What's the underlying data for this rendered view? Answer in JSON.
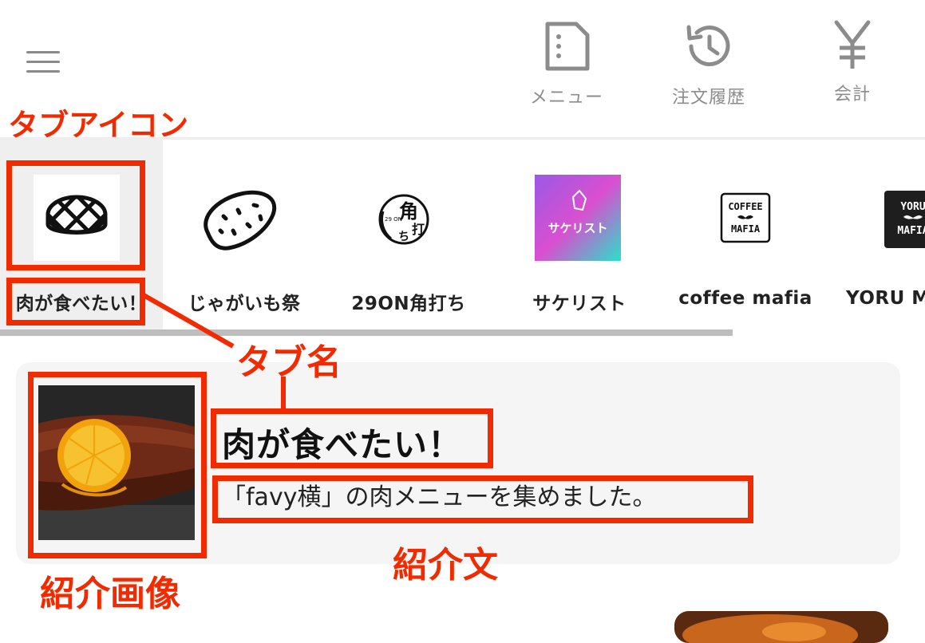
{
  "header": {
    "nav": [
      {
        "label": "メニュー",
        "icon": "menu-document-icon"
      },
      {
        "label": "注文履歴",
        "icon": "history-icon"
      },
      {
        "label": "会計",
        "icon": "yen-icon"
      }
    ]
  },
  "tabs": [
    {
      "label": "肉が食べたい！",
      "icon": "steak-icon",
      "active": true
    },
    {
      "label": "じゃがいも祭",
      "icon": "potato-icon"
    },
    {
      "label": "29ON角打ち",
      "icon": "kakuuchi-logo-icon"
    },
    {
      "label": "サケリスト",
      "icon": "sakelist-logo-icon"
    },
    {
      "label": "coffee mafia",
      "icon": "coffee-mafia-logo-icon"
    },
    {
      "label": "YORU MAFIA",
      "icon": "yoru-mafia-logo-icon"
    }
  ],
  "logos": {
    "kakuuchi_small": "29 ON",
    "kakuuchi_kanji": "角",
    "kakuuchi_kanji2": "打",
    "kakuuchi_kana": "ち",
    "sakelist": "サケリスト",
    "coffee_mafia_line1": "COFFEE",
    "coffee_mafia_line2": "MAFIA",
    "yoru_mafia_line1": "YORU",
    "yoru_mafia_line2": "MAFIA"
  },
  "intro": {
    "title": "肉が食べたい！",
    "description": "「favy横」の肉メニューを集めました。"
  },
  "annotations": {
    "tab_icon": "タブアイコン",
    "tab_name": "タブ名",
    "intro_text": "紹介文",
    "intro_image": "紹介画像"
  },
  "colors": {
    "annotation": "#f22a00",
    "active_tab_bg": "#efefef",
    "nav_gray": "#8c8c8c"
  }
}
